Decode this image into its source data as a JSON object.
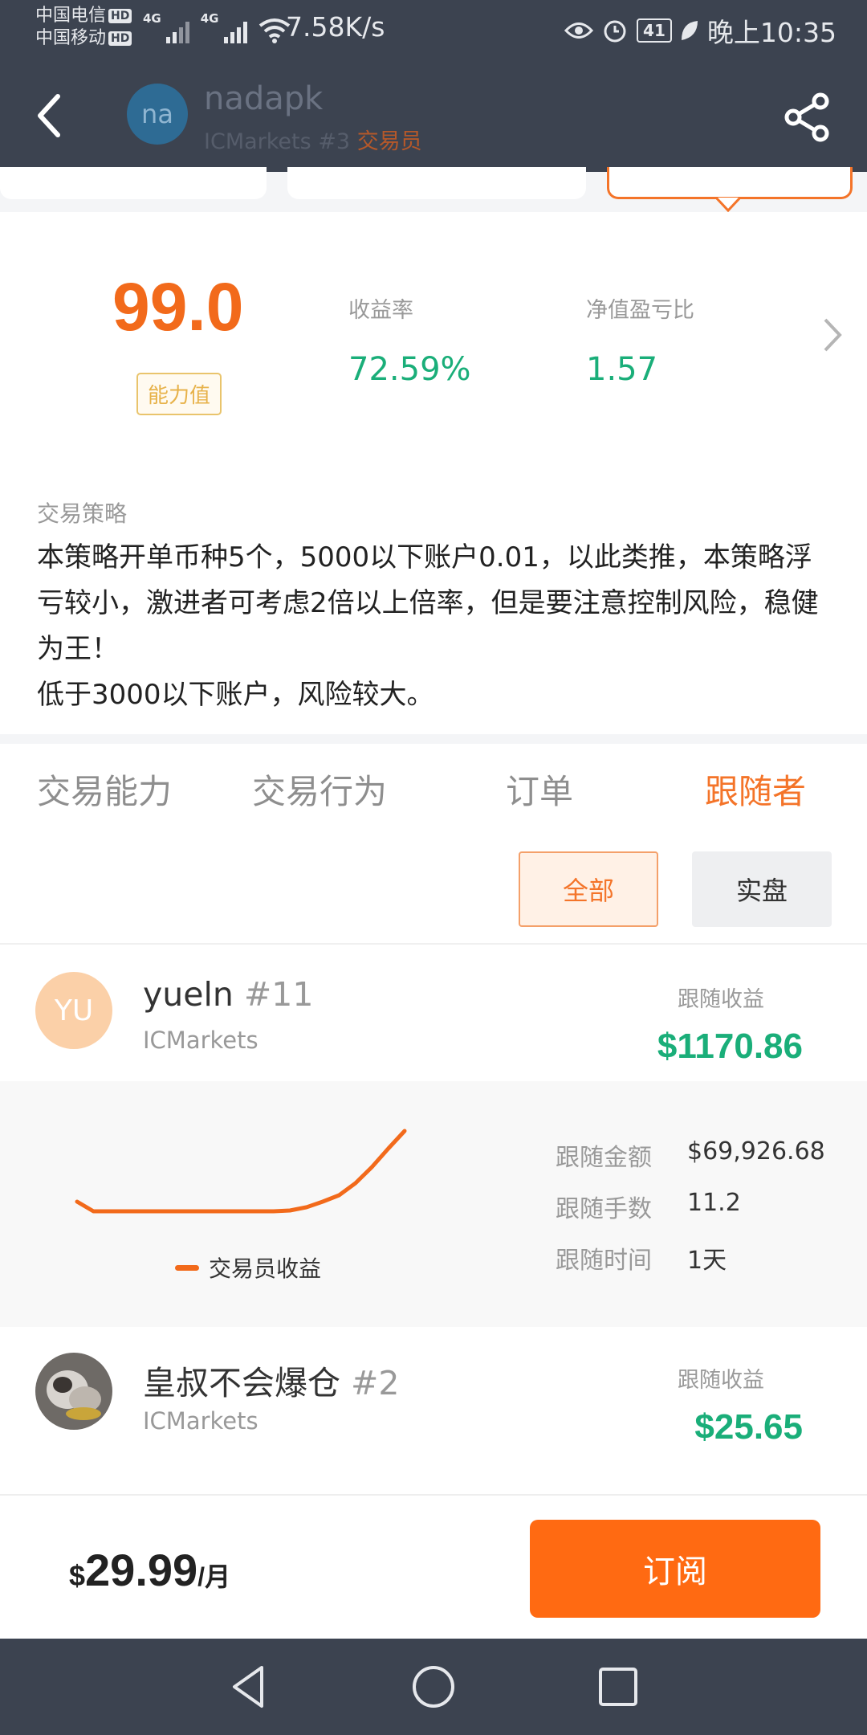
{
  "status_bar": {
    "carrier_1": "中国电信",
    "carrier_2": "中国移动",
    "hd": "HD",
    "net_1": "4G",
    "net_2": "4G",
    "speed": "7.58K/s",
    "battery": "41",
    "time": "晚上10:35"
  },
  "header": {
    "avatar_initials": "na",
    "name": "nadapk",
    "broker_rank": "ICMarkets #3",
    "role": "交易员"
  },
  "score": {
    "value": "99.0",
    "tag": "能力值",
    "metrics": [
      {
        "label": "收益率",
        "value": "72.59%"
      },
      {
        "label": "净值盈亏比",
        "value": "1.57"
      }
    ]
  },
  "strategy": {
    "label": "交易策略",
    "text": "本策略开单币种5个，5000以下账户0.01，以此类推，本策略浮亏较小，激进者可考虑2倍以上倍率，但是要注意控制风险，稳健为王！\n低于3000以下账户，风险较大。"
  },
  "tabs": [
    "交易能力",
    "交易行为",
    "订单",
    "跟随者"
  ],
  "active_tab": "跟随者",
  "filters": {
    "all": "全部",
    "real": "实盘",
    "selected": "全部"
  },
  "followers": [
    {
      "initials": "YU",
      "name": "yueln",
      "rank": "#11",
      "broker": "ICMarkets",
      "earn_label": "跟随收益",
      "earn_value": "$1170.86"
    },
    {
      "initials": "",
      "name": "皇叔不会爆仓",
      "rank": "#2",
      "broker": "ICMarkets",
      "earn_label": "跟随收益",
      "earn_value": "$25.65"
    }
  ],
  "detail": {
    "legend": "交易员收益",
    "stats": [
      {
        "label": "跟随金额",
        "value": "$69,926.68"
      },
      {
        "label": "跟随手数",
        "value": "11.2"
      },
      {
        "label": "跟随时间",
        "value": "1天"
      }
    ]
  },
  "chart_data": {
    "type": "line",
    "series": [
      {
        "name": "交易员收益",
        "values": [
          0.12,
          0.0,
          0.0,
          0.0,
          0.0,
          0.0,
          0.0,
          0.0,
          0.0,
          0.0,
          0.0,
          0.0,
          0.0,
          0.01,
          0.05,
          0.12,
          0.2,
          0.35,
          0.55,
          0.78,
          1.0
        ]
      }
    ],
    "color": "#f26a1b"
  },
  "bottom": {
    "currency": "$",
    "price": "29.99",
    "per": "/月",
    "subscribe": "订阅"
  },
  "colors": {
    "accent": "#f47429",
    "positive": "#1aae79",
    "header_bg": "#3c4350"
  }
}
